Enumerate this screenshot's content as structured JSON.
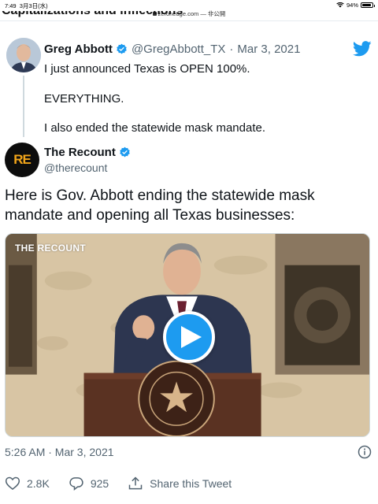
{
  "status_bar": {
    "time": "7:49",
    "date": "3月3日(水)",
    "url": "zerohedge.com",
    "url_suffix": "— 非公開",
    "battery": "94%",
    "battery_level": 0.94
  },
  "page": {
    "cut_heading": "Capitalizations and inflections"
  },
  "quoted_tweet": {
    "name": "Greg Abbott",
    "handle": "@GregAbbott_TX",
    "date": "Mar 3, 2021",
    "lines": [
      "I just announced Texas is OPEN 100%.",
      "EVERYTHING.",
      "I also ended the statewide mask mandate."
    ]
  },
  "tweet": {
    "name": "The Recount",
    "handle": "@therecount",
    "avatar_text": "RE",
    "text": "Here is Gov. Abbott ending the statewide mask mandate and opening all Texas businesses:",
    "video_brand": "THE RECOUNT",
    "timestamp": "5:26 AM · Mar 3, 2021"
  },
  "actions": {
    "likes": "2.8K",
    "replies": "925",
    "share_label": "Share this Tweet"
  },
  "colors": {
    "twitter_blue": "#1d9bf0",
    "recount_orange": "#f2a51a",
    "secondary_text": "#536471"
  }
}
